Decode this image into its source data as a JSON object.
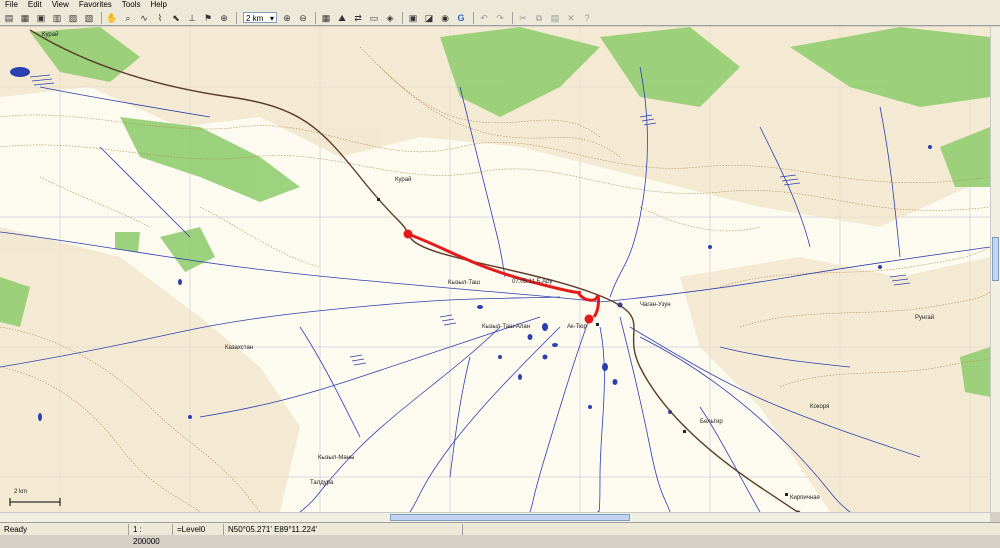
{
  "menu": [
    "File",
    "Edit",
    "View",
    "Favorites",
    "Tools",
    "Help"
  ],
  "toolbar": {
    "scale_value": "2 km"
  },
  "status": {
    "ready": "Ready",
    "scale": "1 : 200000",
    "level": "=Level0",
    "coords": "N50°05.271' E89°11.224'"
  },
  "map": {
    "place_labels": [
      "Курай",
      "Курай",
      "Кызыл-Таш",
      "Ак-Тюр",
      "Кызыл-Таш-Алан",
      "Чаган-Узун",
      "Казахстан",
      "Талдура",
      "Бельтир",
      "Кокоря",
      "Кызыл-Маны",
      "Рунгай",
      "Кирпичная"
    ],
    "route_label": "07.05.11 Б.Ару",
    "scale_bar": "2 km",
    "colors": {
      "route": "#e31b1b",
      "water": "#2c3fb0",
      "forest": "#8ccb6a",
      "contour": "#b08a4a",
      "road": "#5a3b2a"
    }
  }
}
